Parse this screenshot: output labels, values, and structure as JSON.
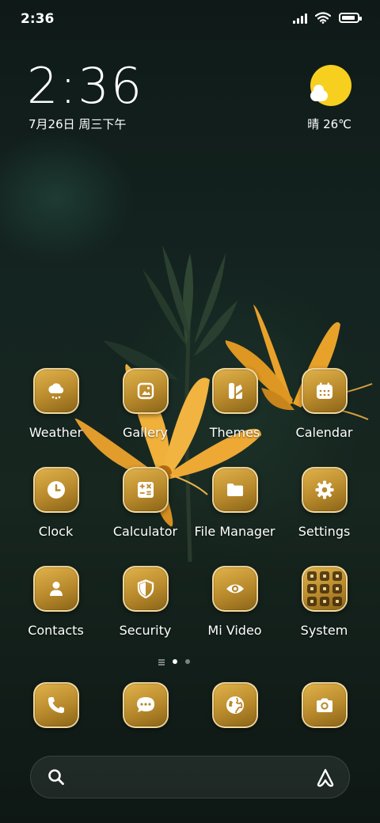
{
  "status_bar": {
    "time": "2:36",
    "icons": [
      "signal-icon",
      "wifi-icon",
      "battery-icon"
    ],
    "battery_level": 0.9
  },
  "clock_widget": {
    "time": "2:36",
    "date": "7月26日 周三下午"
  },
  "weather_widget": {
    "icon": "sun-cloud-icon",
    "text": "晴 26℃"
  },
  "apps": [
    {
      "label": "Weather",
      "icon": "weather-cloud-icon"
    },
    {
      "label": "Gallery",
      "icon": "gallery-icon"
    },
    {
      "label": "Themes",
      "icon": "themes-icon"
    },
    {
      "label": "Calendar",
      "icon": "calendar-icon"
    },
    {
      "label": "Clock",
      "icon": "clock-icon"
    },
    {
      "label": "Calculator",
      "icon": "calculator-icon"
    },
    {
      "label": "File Manager",
      "icon": "folder-icon"
    },
    {
      "label": "Settings",
      "icon": "gear-icon"
    },
    {
      "label": "Contacts",
      "icon": "person-icon"
    },
    {
      "label": "Security",
      "icon": "shield-icon"
    },
    {
      "label": "Mi Video",
      "icon": "eye-icon"
    },
    {
      "label": "System",
      "icon": "folder-grid-icon"
    }
  ],
  "page_indicator": {
    "pages": 2,
    "current": 1
  },
  "dock": [
    {
      "icon": "phone-icon"
    },
    {
      "icon": "messages-icon"
    },
    {
      "icon": "browser-globe-icon"
    },
    {
      "icon": "camera-icon"
    }
  ],
  "search_bar": {
    "placeholder": ""
  },
  "colors": {
    "accent_gold": "#c99a35",
    "sun": "#f7cf1e",
    "background": "#142420"
  }
}
